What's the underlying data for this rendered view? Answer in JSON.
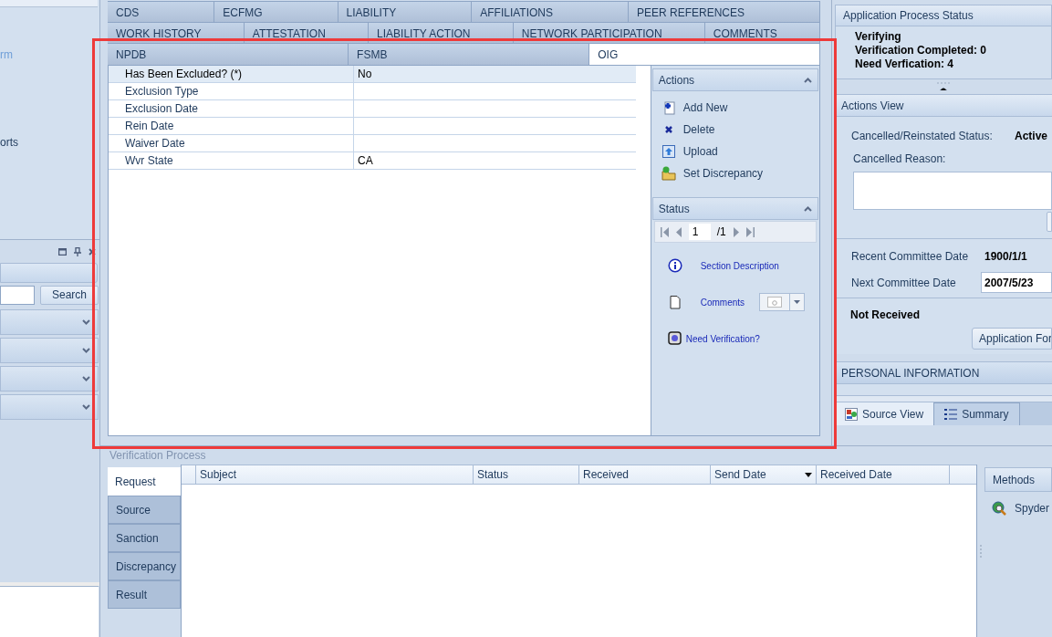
{
  "left_panel": {
    "cut_texts": [
      "rm",
      "orts"
    ],
    "search_button": "Search"
  },
  "tab_rows": [
    [
      {
        "label": "CDS",
        "selected": false
      },
      {
        "label": "ECFMG",
        "selected": false
      },
      {
        "label": "LIABILITY",
        "selected": false
      },
      {
        "label": "AFFILIATIONS",
        "selected": false
      },
      {
        "label": "PEER REFERENCES",
        "selected": false
      }
    ],
    [
      {
        "label": "WORK HISTORY",
        "selected": false
      },
      {
        "label": "ATTESTATION",
        "selected": false
      },
      {
        "label": "LIABILITY ACTION",
        "selected": false
      },
      {
        "label": "NETWORK PARTICIPATION",
        "selected": false
      },
      {
        "label": "COMMENTS",
        "selected": false
      }
    ],
    [
      {
        "label": "NPDB",
        "selected": false
      },
      {
        "label": "FSMB",
        "selected": false
      },
      {
        "label": "OIG",
        "selected": true
      }
    ]
  ],
  "form": {
    "rows": [
      {
        "label": "Has Been Excluded? (*)",
        "value": "No",
        "selected": true
      },
      {
        "label": "Exclusion Type",
        "selected": false
      },
      {
        "label": "Exclusion Date",
        "selected": false
      },
      {
        "label": "Rein Date",
        "selected": false
      },
      {
        "label": "Waiver Date",
        "selected": false
      },
      {
        "label": "Wvr State",
        "value": "CA",
        "selected": false
      }
    ]
  },
  "actions_pane": {
    "title": "Actions",
    "expanded": true,
    "items": [
      {
        "kind": "add",
        "label": "Add New"
      },
      {
        "kind": "delete",
        "label": "Delete"
      },
      {
        "kind": "upload",
        "label": "Upload"
      },
      {
        "kind": "discrepancy",
        "label": "Set Discrepancy"
      }
    ]
  },
  "status_pane": {
    "title": "Status",
    "expanded": true,
    "page": "1",
    "total": "/1",
    "links": [
      {
        "kind": "info",
        "label": "Section Description"
      },
      {
        "kind": "comments",
        "label": "Comments"
      },
      {
        "kind": "verify",
        "label": "Need Verification?"
      }
    ]
  },
  "verification": {
    "title": "Verification Process",
    "tabs": [
      {
        "label": "Request",
        "selected": true
      },
      {
        "label": "Source",
        "selected": false
      },
      {
        "label": "Sanction",
        "selected": false
      },
      {
        "label": "Discrepancy",
        "selected": false
      },
      {
        "label": "Result",
        "selected": false
      }
    ],
    "columns": [
      {
        "label": "Subject",
        "sorted": false
      },
      {
        "label": "Status",
        "sorted": false
      },
      {
        "label": "Received",
        "sorted": false
      },
      {
        "label": "Send Date",
        "sorted": true
      },
      {
        "label": "Received Date",
        "sorted": false
      }
    ]
  },
  "methods": {
    "title": "Methods",
    "items": [
      "Spyder"
    ]
  },
  "right_panel": {
    "process_status": {
      "title": "Application Process Status",
      "lines": [
        "Verifying",
        "Verification Completed: 0",
        "Need Verfication: 4"
      ]
    },
    "actions_view": {
      "title": "Actions View",
      "status_label": "Cancelled/Reinstated Status:",
      "status_value": "Active",
      "reason_label": "Cancelled Reason:",
      "recent_label": "Recent Committee Date",
      "recent_value": "1900/1/1",
      "next_label": "Next Committee Date",
      "next_value": "2007/5/23",
      "received": "Not Received",
      "button": "Application For"
    },
    "section_header": "PERSONAL INFORMATION",
    "tabs": [
      {
        "kind": "source",
        "label": "Source View",
        "selected": true
      },
      {
        "kind": "summary",
        "label": "Summary",
        "selected": false
      }
    ]
  }
}
